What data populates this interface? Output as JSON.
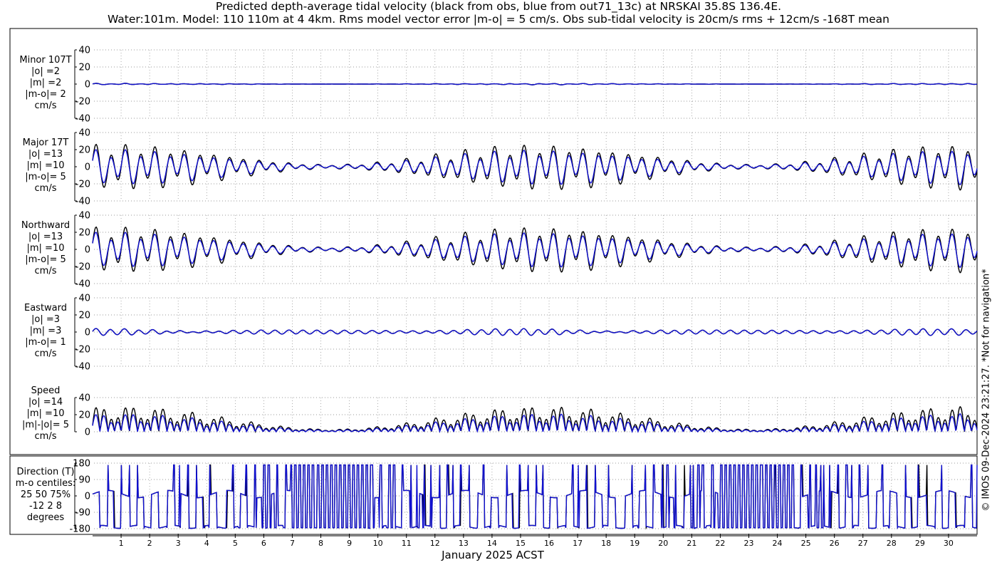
{
  "title_line1": "Predicted depth-average tidal velocity (black from obs, blue from out71_13c) at NRSKAI 35.8S 136.4E.",
  "title_line2": "Water:101m. Model: 110 110m at 4 4km. Rms model vector error |m-o| = 5 cm/s. Obs sub-tidal velocity is 20cm/s rms + 12cm/s -168T mean",
  "watermark": "© IMOS 09-Dec-2024 23:21:27. *Not for navigation*",
  "colors": {
    "obs": "#000000",
    "model": "#1010d0"
  },
  "chart_data": {
    "type": "line",
    "xlabel": "January 2025 ACST",
    "x_ticks": [
      "1",
      "2",
      "3",
      "4",
      "5",
      "6",
      "7",
      "8",
      "9",
      "10",
      "11",
      "12",
      "13",
      "14",
      "15",
      "16",
      "17",
      "18",
      "19",
      "20",
      "21",
      "22",
      "23",
      "24",
      "25",
      "26",
      "27",
      "28",
      "29",
      "30"
    ],
    "xlim": [
      0,
      31
    ],
    "grid": true,
    "series_names": [
      "obs",
      "model"
    ],
    "panels": [
      {
        "id": "minor",
        "label": [
          "Minor 107T",
          "|o| =2",
          "|m| =2",
          "|m-o|= 2",
          "cm/s"
        ],
        "ylim": [
          -40,
          40
        ],
        "yticks": [
          "40",
          "20",
          "0",
          "-20",
          "-40"
        ],
        "amplitude_obs": 2,
        "amplitude_model": 2
      },
      {
        "id": "major",
        "label": [
          "Major 17T",
          "|o| =13",
          "|m| =10",
          "|m-o|= 5",
          "cm/s"
        ],
        "ylim": [
          -40,
          40
        ],
        "yticks": [
          "40",
          "20",
          "0",
          "-20",
          "-40"
        ],
        "amplitude_obs": 13,
        "amplitude_model": 10
      },
      {
        "id": "northward",
        "label": [
          "Northward",
          "|o| =13",
          "|m| =10",
          "|m-o|= 5",
          "cm/s"
        ],
        "ylim": [
          -40,
          40
        ],
        "yticks": [
          "40",
          "20",
          "0",
          "-20",
          "-40"
        ],
        "amplitude_obs": 13,
        "amplitude_model": 10
      },
      {
        "id": "eastward",
        "label": [
          "Eastward",
          "|o| =3",
          "|m| =3",
          "|m-o|= 1",
          "cm/s"
        ],
        "ylim": [
          -40,
          40
        ],
        "yticks": [
          "40",
          "20",
          "0",
          "-20",
          "-40"
        ],
        "amplitude_obs": 3,
        "amplitude_model": 3
      },
      {
        "id": "speed",
        "label": [
          "Speed",
          "|o| =14",
          "|m| =10",
          "|m|-|o|= 5",
          "cm/s"
        ],
        "ylim": [
          0,
          40
        ],
        "yticks": [
          "40",
          "20",
          "0"
        ],
        "amplitude_obs": 14,
        "amplitude_model": 10
      },
      {
        "id": "direction",
        "label": [
          "Direction (T)",
          "m-o centiles:",
          "25  50  75%",
          "-12   2   8",
          "degrees"
        ],
        "ylim": [
          -180,
          180
        ],
        "yticks": [
          "180",
          "90",
          "0",
          "-90",
          "-180"
        ]
      }
    ]
  }
}
